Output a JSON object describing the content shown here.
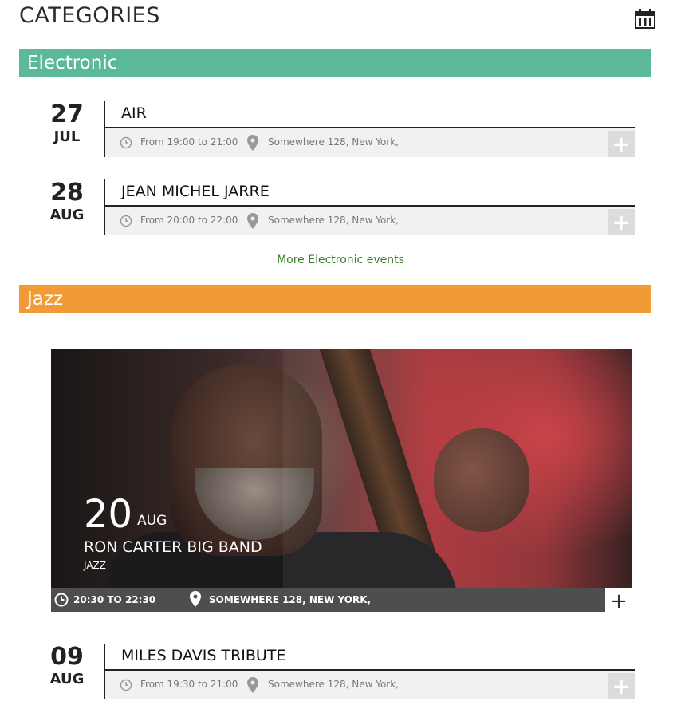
{
  "header": {
    "title": "CATEGORIES",
    "calendar_icon": "calendar-icon"
  },
  "categories": [
    {
      "name": "Electronic",
      "color": "#5cb89a",
      "events": [
        {
          "day": "27",
          "month": "JUL",
          "title": "AIR",
          "time": "From 19:00 to 21:00",
          "place": "Somewhere 128, New York,"
        },
        {
          "day": "28",
          "month": "AUG",
          "title": "JEAN MICHEL JARRE",
          "time": "From 20:00 to 22:00",
          "place": "Somewhere 128, New York,"
        }
      ],
      "more_label": "More Electronic events"
    },
    {
      "name": "Jazz",
      "color": "#f09b36",
      "featured": {
        "day": "20",
        "month": "AUG",
        "title": "RON CARTER BIG BAND",
        "category": "JAZZ",
        "time": "20:30 TO 22:30",
        "place": "SOMEWHERE 128, NEW YORK,"
      },
      "events": [
        {
          "day": "09",
          "month": "AUG",
          "title": "MILES DAVIS TRIBUTE",
          "time": "From 19:30 to 21:00",
          "place": "Somewhere 128, New York,"
        }
      ]
    }
  ],
  "plus_label": "+"
}
